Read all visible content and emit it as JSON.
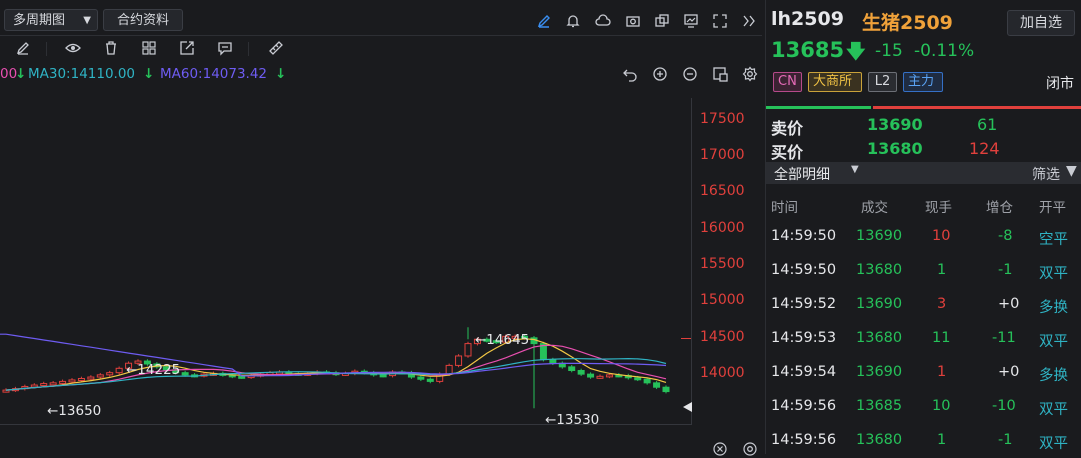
{
  "toolbar": {
    "period_label": "多周期图",
    "contract_label": "合约资料"
  },
  "ma_legend": {
    "ma_tail": "00",
    "ma30": "MA30:14110.00",
    "ma60": "MA60:14073.42"
  },
  "price_axis": [
    "17500",
    "17000",
    "16500",
    "16000",
    "15500",
    "15000",
    "14500",
    "14000"
  ],
  "chart_annotations": {
    "high_left": "←14225",
    "low_left": "←13650",
    "high_mid": "←14645",
    "low_right": "←13530"
  },
  "chart_data": {
    "type": "candlestick",
    "ylim": [
      13300,
      17800
    ],
    "ma_series": [
      {
        "name": "MA30",
        "value": 14110.0,
        "color": "#2fb3c4"
      },
      {
        "name": "MA60",
        "value": 14073.42,
        "color": "#6e5cf2"
      }
    ],
    "annotated_points": [
      {
        "label": "14225",
        "type": "high"
      },
      {
        "label": "13650",
        "type": "low"
      },
      {
        "label": "14645",
        "type": "high"
      },
      {
        "label": "13530",
        "type": "low"
      }
    ]
  },
  "quote": {
    "code": "lh2509",
    "name": "生猪2509",
    "add_fav": "加自选",
    "price": "13685",
    "change": "-15",
    "change_pct": "-0.11%",
    "status": "闭市"
  },
  "tags": {
    "cn": "CN",
    "exchange": "大商所",
    "level": "L2",
    "main": "主力"
  },
  "orderbook": {
    "sell_label": "卖价",
    "sell_price": "13690",
    "sell_vol": "61",
    "buy_label": "买价",
    "buy_price": "13680",
    "buy_vol": "124"
  },
  "detail": {
    "tab_label": "全部明细",
    "filter_label": "筛选",
    "headers": [
      "时间",
      "成交",
      "现手",
      "增仓",
      "开平"
    ],
    "rows": [
      {
        "time": "14:59:50",
        "price": "13690",
        "vol": "10",
        "oi": "-8",
        "type": "空平"
      },
      {
        "time": "14:59:50",
        "price": "13680",
        "vol": "1",
        "oi": "-1",
        "type": "双平"
      },
      {
        "time": "14:59:52",
        "price": "13690",
        "vol": "3",
        "oi": "+0",
        "type": "多换"
      },
      {
        "time": "14:59:53",
        "price": "13680",
        "vol": "11",
        "oi": "-11",
        "type": "双平"
      },
      {
        "time": "14:59:54",
        "price": "13690",
        "vol": "1",
        "oi": "+0",
        "type": "多换"
      },
      {
        "time": "14:59:56",
        "price": "13685",
        "vol": "10",
        "oi": "-10",
        "type": "双平"
      },
      {
        "time": "14:59:56",
        "price": "13680",
        "vol": "1",
        "oi": "-1",
        "type": "双平"
      }
    ]
  }
}
